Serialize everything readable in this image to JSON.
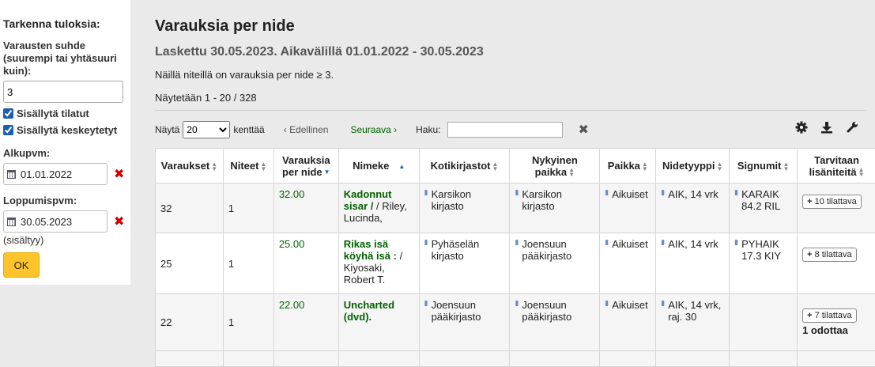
{
  "sidebar": {
    "heading": "Tarkenna tuloksia:",
    "ratio_label": "Varausten suhde (suurempi tai yhtäsuuri kuin):",
    "ratio_value": "3",
    "include_ordered": "Sisällytä tilatut",
    "include_suspended": "Sisällytä keskeytetyt",
    "from_label": "Alkupvm:",
    "from_value": "01.01.2022",
    "to_label": "Loppumispvm:",
    "to_value": "30.05.2023",
    "included_note": "(sisältyy)",
    "ok_label": "OK"
  },
  "main": {
    "title": "Varauksia per nide",
    "subtitle": "Laskettu 30.05.2023. Aikavälillä 01.01.2022 - 30.05.2023",
    "info": "Näillä niteillä on varauksia per nide ≥ 3.",
    "showing": "Näytetään 1 - 20 / 328",
    "show_label": "Näytä",
    "page_size": "20",
    "entries_label": "kenttää",
    "prev": "‹ Edellinen",
    "next": "Seuraava ›",
    "search_label": "Haku:"
  },
  "table": {
    "headers": {
      "holds": "Varaukset",
      "items": "Niteet",
      "ratio": "Varauksia per nide",
      "title": "Nimeke",
      "home_libs": "Kotikirjastot",
      "current_loc": "Nykyinen paikka",
      "location": "Paikka",
      "itemtype": "Nidetyyppi",
      "callnumber": "Signumit",
      "needed": "Tarvitaan lisäniteitä"
    },
    "rows": [
      {
        "holds": "32",
        "items": "1",
        "ratio": "32.00",
        "title": "Kadonnut sisar /",
        "author": " / Riley, Lucinda,",
        "home": "Karsikon kirjasto",
        "current": "Karsikon kirjasto",
        "location": "Aikuiset",
        "itemtype": "AIK, 14 vrk",
        "callnumber": "KARAIK 84.2 RIL",
        "order": "10 tilattava",
        "waiting": ""
      },
      {
        "holds": "25",
        "items": "1",
        "ratio": "25.00",
        "title": "Rikas isä köyhä isä :",
        "author": " / Kiyosaki, Robert T.",
        "home": "Pyhäselän kirjasto",
        "current": "Joensuun pääkirjasto",
        "location": "Aikuiset",
        "itemtype": "AIK, 14 vrk",
        "callnumber": "PYHAIK 17.3 KIY",
        "order": "8 tilattava",
        "waiting": ""
      },
      {
        "holds": "22",
        "items": "1",
        "ratio": "22.00",
        "title": "Uncharted (dvd).",
        "author": "",
        "home": "Joensuun pääkirjasto",
        "current": "Joensuun pääkirjasto",
        "location": "Aikuiset",
        "itemtype": "AIK, 14 vrk, raj. 30",
        "callnumber": "",
        "order": "7 tilattava",
        "waiting": "1 odottaa"
      }
    ]
  }
}
